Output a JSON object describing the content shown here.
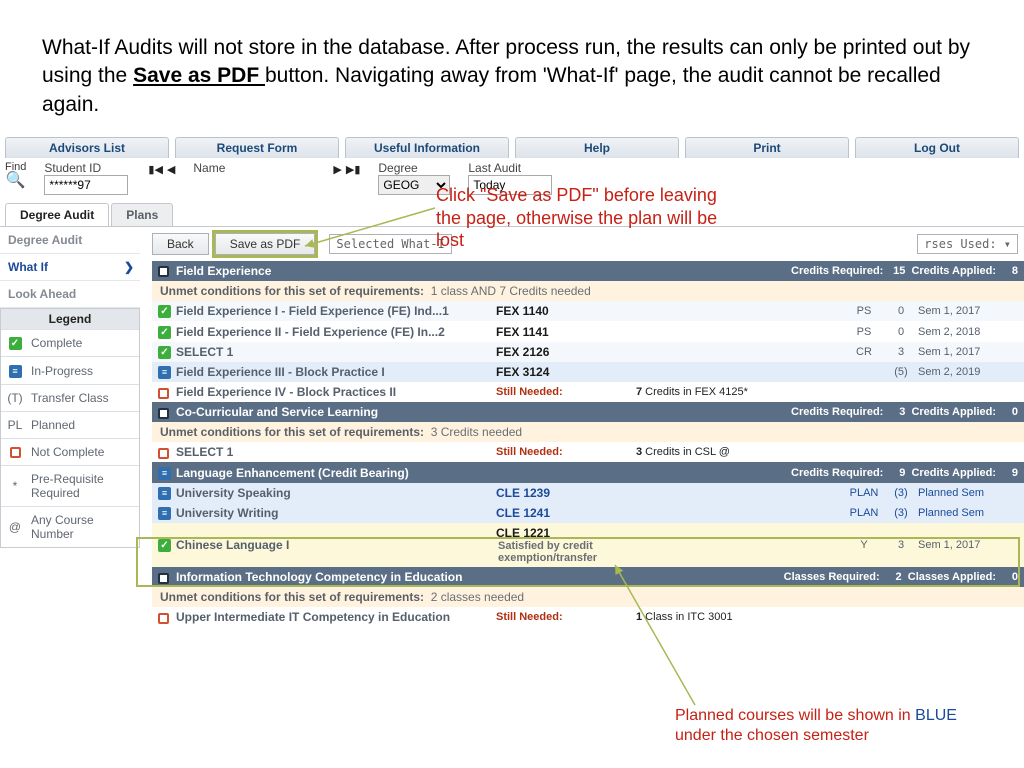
{
  "instruction": {
    "pre": "What-If Audits will not store in the database. After process run, the results can only be printed out by using the ",
    "bold": "Save as PDF ",
    "post": "button. Navigating away from 'What-If' page, the audit cannot be recalled again."
  },
  "topnav": [
    "Advisors List",
    "Request Form",
    "Useful Information",
    "Help",
    "Print",
    "Log Out"
  ],
  "toolbar": {
    "find": "Find",
    "student_id_label": "Student ID",
    "student_id": "******97",
    "name_label": "Name",
    "degree_label": "Degree",
    "degree": "GEOG",
    "last_audit_label": "Last Audit",
    "last_audit": "Today"
  },
  "subtabs": {
    "audit": "Degree Audit",
    "plans": "Plans"
  },
  "sidemenu": {
    "audit": "Degree Audit",
    "whatif": "What If",
    "lookahead": "Look Ahead"
  },
  "legend": {
    "header": "Legend",
    "items": [
      {
        "icon": "green",
        "label": "Complete"
      },
      {
        "icon": "blue",
        "label": "In-Progress"
      },
      {
        "icon": "(T)",
        "label": "Transfer Class"
      },
      {
        "icon": "PL",
        "label": "Planned"
      },
      {
        "icon": "emptyred",
        "label": "Not Complete"
      },
      {
        "icon": "*",
        "label": "Pre-Requisite Required"
      },
      {
        "icon": "@",
        "label": "Any Course Number"
      }
    ]
  },
  "controls": {
    "back": "Back",
    "save_pdf": "Save as PDF",
    "selected": "Selected What-I",
    "courses_used": "rses Used: ▾"
  },
  "labels": {
    "credits_required": "Credits Required:",
    "credits_applied": "Credits Applied:",
    "classes_required": "Classes Required:",
    "classes_applied": "Classes Applied:",
    "unmet_prefix": "Unmet conditions for this set of requirements:",
    "still_needed": "Still Needed:"
  },
  "blocks": [
    {
      "title": "Field Experience",
      "icon": "dark",
      "req": 15,
      "app": 8,
      "metric": "credits",
      "unmet": "1 class AND 7 Credits needed",
      "rows": [
        {
          "icon": "green",
          "name": "Field Experience I - Field Experience (FE) Ind...1",
          "code": "FEX 1140",
          "g": "PS",
          "cr": "0",
          "term": "Sem 1, 2017",
          "alt": "alt0"
        },
        {
          "icon": "green",
          "name": "Field Experience II - Field Experience (FE) In...2",
          "code": "FEX 1141",
          "g": "PS",
          "cr": "0",
          "term": "Sem 2, 2018",
          "alt": "alt1"
        },
        {
          "icon": "green",
          "name": "SELECT 1",
          "code": "FEX 2126",
          "g": "CR",
          "cr": "3",
          "term": "Sem 1, 2017",
          "alt": "alt0"
        },
        {
          "icon": "blue",
          "name": "Field Experience III - Block Practice I",
          "code": "FEX 3124",
          "g": "",
          "cr": "(5)",
          "term": "Sem 2, 2019",
          "alt": "alt-blue"
        },
        {
          "icon": "emptyred",
          "name": "Field Experience IV - Block Practices II",
          "still": true,
          "need": "7 Credits in FEX 4125*",
          "alt": "alt1"
        }
      ]
    },
    {
      "title": "Co-Curricular and Service Learning",
      "icon": "dark",
      "req": 3,
      "app": 0,
      "metric": "credits",
      "unmet": "3 Credits needed",
      "rows": [
        {
          "icon": "emptyred",
          "name": "SELECT 1",
          "still": true,
          "need": "3 Credits in CSL @",
          "alt": "alt1"
        }
      ]
    },
    {
      "title": "Language Enhancement (Credit Bearing)",
      "icon": "blue",
      "req": 9,
      "app": 9,
      "metric": "credits",
      "unmet": null,
      "rows": [
        {
          "icon": "blue",
          "name": "University Speaking",
          "code": "CLE 1239",
          "codeblue": true,
          "g": "PLAN",
          "cr": "(3)",
          "term": "Planned Sem",
          "blue": true,
          "alt": "alt-blue"
        },
        {
          "icon": "blue",
          "name": "University Writing",
          "code": "CLE 1241",
          "codeblue": true,
          "g": "PLAN",
          "cr": "(3)",
          "term": "Planned Sem",
          "blue": true,
          "alt": "alt-blue"
        },
        {
          "icon": "green",
          "name": "Chinese Language I",
          "code": "CLE 1221",
          "satisfied": "Satisfied by credit exemption/transfer",
          "g": "Y",
          "cr": "3",
          "term": "Sem 1, 2017",
          "alt": "alt-yellow"
        }
      ]
    },
    {
      "title": "Information Technology Competency in Education",
      "icon": "dark",
      "req": 2,
      "app": 0,
      "metric": "classes",
      "unmet": "2 classes needed",
      "rows": [
        {
          "icon": "emptyred",
          "name": "Upper Intermediate IT Competency in Education",
          "still": true,
          "need": "1 Class in ITC 3001",
          "alt": "alt1"
        }
      ]
    }
  ],
  "annotations": {
    "a1": "Click \"Save as PDF\" before leaving the page, otherwise the plan will be lost",
    "a2_pre": "Planned courses will be shown in ",
    "a2_blue": "BLUE",
    "a2_post": " under the chosen semester"
  }
}
